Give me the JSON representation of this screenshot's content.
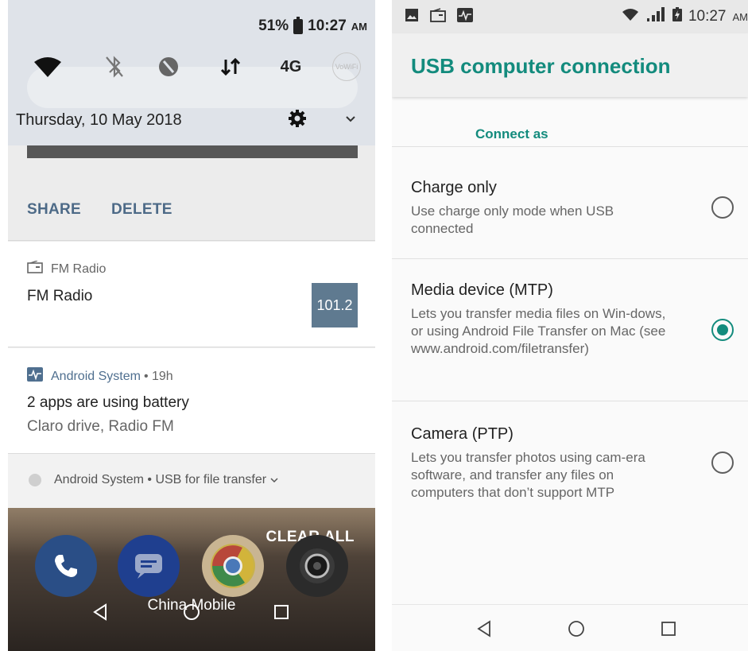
{
  "left": {
    "status": {
      "battery": "51%",
      "time": "10:27",
      "ampm": "AM"
    },
    "tiles": [
      {
        "icon": "wifi-icon"
      },
      {
        "icon": "bluetooth-off-icon"
      },
      {
        "icon": "location-off-icon"
      },
      {
        "icon": "data-transfer-icon"
      },
      {
        "label": "4G"
      },
      {
        "label": "VoWiFi"
      }
    ],
    "date": "Thursday, 10 May 2018",
    "actions": {
      "share": "SHARE",
      "delete": "DELETE"
    },
    "notifications": [
      {
        "app": "FM Radio",
        "title": "FM Radio",
        "frequency": "101.2"
      },
      {
        "app": "Android System",
        "time": "• 19h",
        "title": "2 apps are using battery",
        "text": "Claro drive, Radio FM"
      }
    ],
    "usb_notice": {
      "app": "Android System",
      "text": "• USB for file transfer"
    },
    "clear_all": "CLEAR ALL",
    "carrier": "China Mobile"
  },
  "right": {
    "status": {
      "time": "10:27",
      "ampm": "AM"
    },
    "title": "USB computer connection",
    "section": "Connect as",
    "options": [
      {
        "title": "Charge only",
        "desc": "Use charge only mode when USB connected",
        "selected": false
      },
      {
        "title": "Media device (MTP)",
        "desc": "Lets you transfer media files on Win-dows, or using Android File Transfer on Mac (see www.android.com/filetransfer)",
        "selected": true
      },
      {
        "title": "Camera (PTP)",
        "desc": "Lets you transfer photos using cam-era software, and transfer any files on computers that don’t support MTP",
        "selected": false
      }
    ]
  },
  "colors": {
    "accent": "#138b7d",
    "action": "#4d6a87"
  }
}
